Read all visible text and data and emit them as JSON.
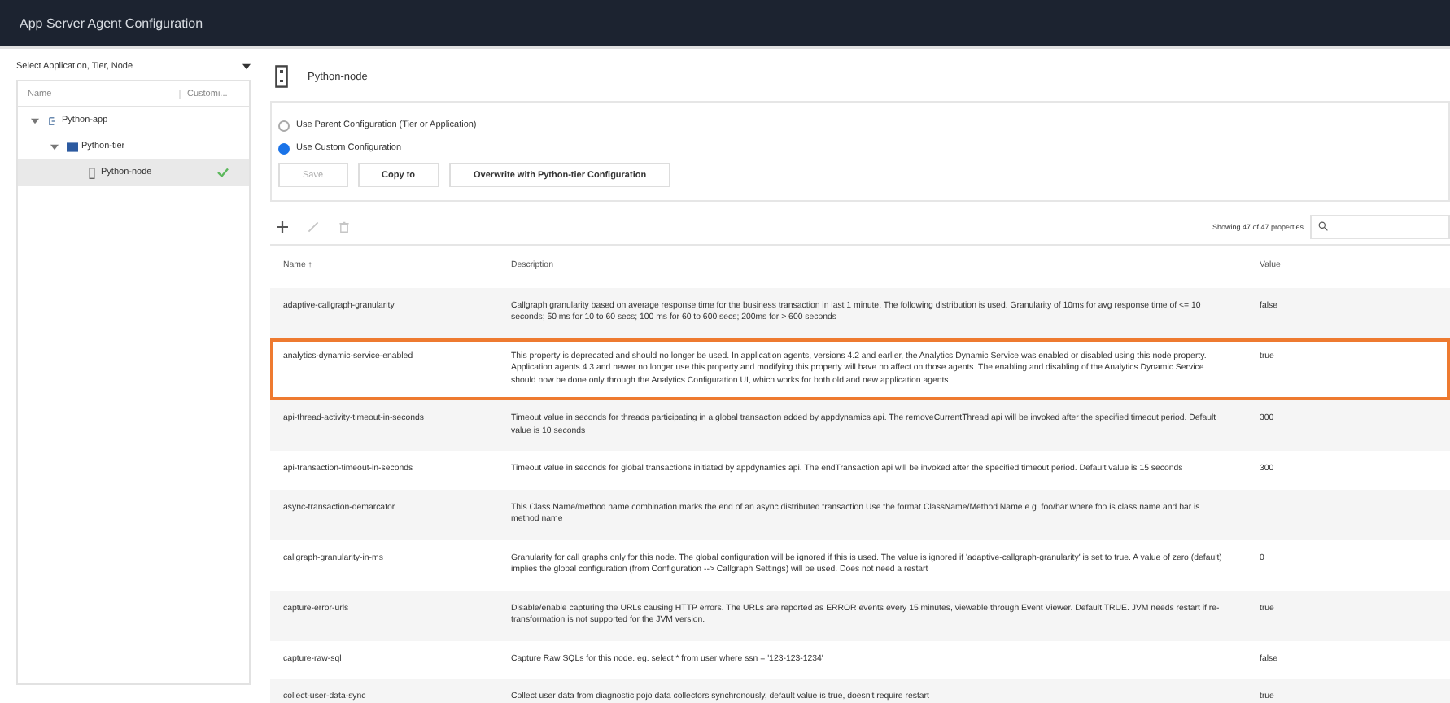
{
  "window": {
    "title": "App Server Agent Configuration"
  },
  "sidebar": {
    "label": "Select Application, Tier, Node",
    "columns": [
      "Name",
      "Customi..."
    ],
    "tree": [
      {
        "label": "Python-app",
        "kind": "app",
        "expanded": true,
        "selected": false,
        "customized": false,
        "children": [
          {
            "label": "Python-tier",
            "kind": "tier",
            "expanded": true,
            "selected": false,
            "customized": false,
            "children": [
              {
                "label": "Python-node",
                "kind": "node",
                "selected": true,
                "customized": true
              }
            ]
          }
        ]
      }
    ]
  },
  "header": {
    "title": "Python-node"
  },
  "config": {
    "options": [
      {
        "label": "Use Parent Configuration (Tier or Application)",
        "selected": false
      },
      {
        "label": "Use Custom Configuration",
        "selected": true
      }
    ],
    "buttons": [
      {
        "label": "Save",
        "disabled": true
      },
      {
        "label": "Copy to",
        "disabled": false
      },
      {
        "label": "Overwrite with Python-tier Configuration",
        "disabled": false
      }
    ]
  },
  "toolbar": {
    "tools": [
      {
        "kind": "add",
        "disabled": false
      },
      {
        "kind": "edit",
        "disabled": true
      },
      {
        "kind": "delete",
        "disabled": true
      }
    ],
    "count": "Showing 47 of 47 properties"
  },
  "table": {
    "columns": [
      "Name ↑",
      "Description",
      "Value"
    ],
    "rows": [
      {
        "name": "adaptive-callgraph-granularity",
        "description": "Callgraph granularity based on average response time for the business transaction in last 1 minute. The following distribution is used. Granularity of 10ms for avg response time of <= 10 seconds; 50 ms for 10 to 60 secs; 100 ms for 60 to 600 secs; 200ms for > 600 seconds",
        "value": "false",
        "highlighted": false
      },
      {
        "name": "analytics-dynamic-service-enabled",
        "description": "This property is deprecated and should no longer be used. In application agents, versions 4.2 and earlier, the Analytics Dynamic Service was enabled or disabled using this node property. Application agents 4.3 and newer no longer use this property and modifying this property will have no affect on those agents. The enabling and disabling of the Analytics Dynamic Service should now be done only through the Analytics Configuration UI, which works for both old and new application agents.",
        "value": "true",
        "highlighted": true
      },
      {
        "name": "api-thread-activity-timeout-in-seconds",
        "description": "Timeout value in seconds for threads participating in a global transaction added by appdynamics api. The removeCurrentThread api will be invoked after the specified timeout period. Default value is 10 seconds",
        "value": "300",
        "highlighted": false
      },
      {
        "name": "api-transaction-timeout-in-seconds",
        "description": "Timeout value in seconds for global transactions initiated by appdynamics api. The endTransaction api will be invoked after the specified timeout period. Default value is 15 seconds",
        "value": "300",
        "highlighted": false
      },
      {
        "name": "async-transaction-demarcator",
        "description": "This Class Name/method name combination marks the end of an async distributed transaction Use the format ClassName/Method Name e.g. foo/bar where foo is class name and bar is method name",
        "value": "",
        "highlighted": false
      },
      {
        "name": "callgraph-granularity-in-ms",
        "description": "Granularity for call graphs only for this node. The global configuration will be ignored if this is used. The value is ignored if 'adaptive-callgraph-granularity' is set to true. A value of zero (default) implies the global configuration (from Configuration --> Callgraph Settings) will be used. Does not need a restart",
        "value": "0",
        "highlighted": false
      },
      {
        "name": "capture-error-urls",
        "description": "Disable/enable capturing the URLs causing HTTP errors. The URLs are reported as ERROR events every 15 minutes, viewable through Event Viewer. Default TRUE. JVM needs restart if re-transformation is not supported for the JVM version.",
        "value": "true",
        "highlighted": false
      },
      {
        "name": "capture-raw-sql",
        "description": "Capture Raw SQLs for this node. eg. select * from user where ssn = '123-123-1234'",
        "value": "false",
        "highlighted": false
      },
      {
        "name": "collect-user-data-sync",
        "description": "Collect user data from diagnostic pojo data collectors synchronously, default value is true, doesn't require restart",
        "value": "true",
        "highlighted": false
      }
    ]
  }
}
